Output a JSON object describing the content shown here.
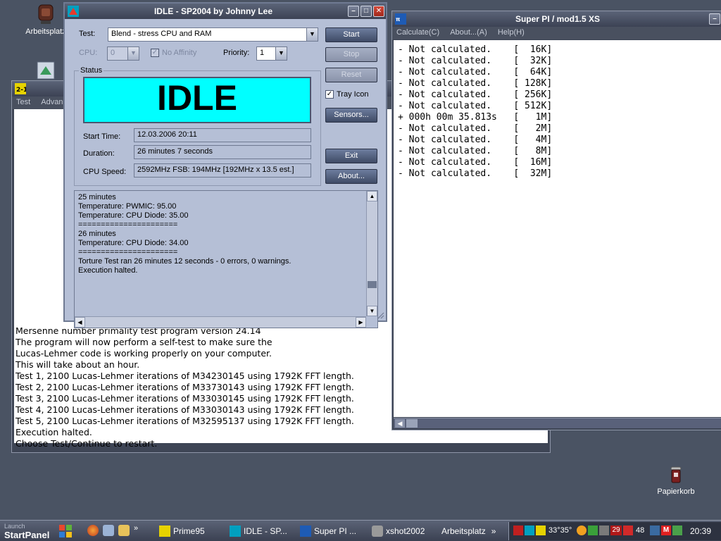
{
  "desktop": {
    "icons": [
      {
        "label": "Arbeitsplatz"
      },
      {
        "label": "Papierkorb"
      }
    ]
  },
  "prime95": {
    "menu": [
      "Test",
      "Advan"
    ],
    "log": [
      "Mersenne number primality test program version 24.14",
      "The program will now perform a self-test to make sure the",
      "Lucas-Lehmer code is working properly on your computer.",
      "This will take about an hour.",
      "Test 1, 2100 Lucas-Lehmer iterations of M34230145 using 1792K FFT length.",
      "Test 2, 2100 Lucas-Lehmer iterations of M33730143 using 1792K FFT length.",
      "Test 3, 2100 Lucas-Lehmer iterations of M33030145 using 1792K FFT length.",
      "Test 4, 2100 Lucas-Lehmer iterations of M33030143 using 1792K FFT length.",
      "Test 5, 2100 Lucas-Lehmer iterations of M32595137 using 1792K FFT length.",
      "Execution halted.",
      "Choose Test/Continue to restart."
    ]
  },
  "sp2004": {
    "title": "IDLE - SP2004 by Johnny Lee",
    "test_label": "Test:",
    "test_value": "Blend - stress CPU and RAM",
    "cpu_label": "CPU:",
    "cpu_value": "0",
    "no_affinity_label": "No Affinity",
    "priority_label": "Priority:",
    "priority_value": "1",
    "buttons": {
      "start": "Start",
      "stop": "Stop",
      "reset": "Reset",
      "sensors": "Sensors...",
      "exit": "Exit",
      "about": "About..."
    },
    "tray_icon_label": "Tray Icon",
    "status": {
      "legend": "Status",
      "state": "IDLE",
      "start_time_label": "Start Time:",
      "start_time": "12.03.2006 20:11",
      "duration_label": "Duration:",
      "duration": "26 minutes 7 seconds",
      "cpu_speed_label": "CPU Speed:",
      "cpu_speed": "2592MHz FSB: 194MHz [192MHz x 13.5 est.]"
    },
    "log": "25 minutes\nTemperature: PWMIC: 95.00\nTemperature: CPU Diode: 35.00\n======================\n26 minutes\nTemperature: CPU Diode: 34.00\n======================\nTorture Test ran 26 minutes 12 seconds - 0 errors, 0 warnings.\nExecution halted."
  },
  "superpi": {
    "title": "Super PI / mod1.5 XS",
    "menu": [
      "Calculate(C)",
      "About...(A)",
      "Help(H)"
    ],
    "results": [
      {
        "status": "- Not calculated.    ",
        "size": "[  16K]"
      },
      {
        "status": "- Not calculated.    ",
        "size": "[  32K]"
      },
      {
        "status": "- Not calculated.    ",
        "size": "[  64K]"
      },
      {
        "status": "- Not calculated.    ",
        "size": "[ 128K]"
      },
      {
        "status": "- Not calculated.    ",
        "size": "[ 256K]"
      },
      {
        "status": "- Not calculated.    ",
        "size": "[ 512K]"
      },
      {
        "status": "+ 000h 00m 35.813s   ",
        "size": "[   1M]"
      },
      {
        "status": "- Not calculated.    ",
        "size": "[   2M]"
      },
      {
        "status": "- Not calculated.    ",
        "size": "[   4M]"
      },
      {
        "status": "- Not calculated.    ",
        "size": "[   8M]"
      },
      {
        "status": "- Not calculated.    ",
        "size": "[  16M]"
      },
      {
        "status": "- Not calculated.    ",
        "size": "[  32M]"
      }
    ]
  },
  "taskbar": {
    "launch_label": "Launch",
    "start_label": "StartPanel",
    "tasks": [
      {
        "label": "Prime95"
      },
      {
        "label": "IDLE - SP..."
      },
      {
        "label": "Super PI ..."
      },
      {
        "label": "xshot2002"
      },
      {
        "label": "Arbeitsplatz"
      }
    ],
    "tray_temps": "33°35°",
    "tray_badge": "29",
    "tray_number": "48",
    "clock": "20:39"
  },
  "colors": {
    "idle_bg": "#00ffff",
    "window_bg": "#b5bfd6",
    "desktop_bg": "#4a5363"
  }
}
